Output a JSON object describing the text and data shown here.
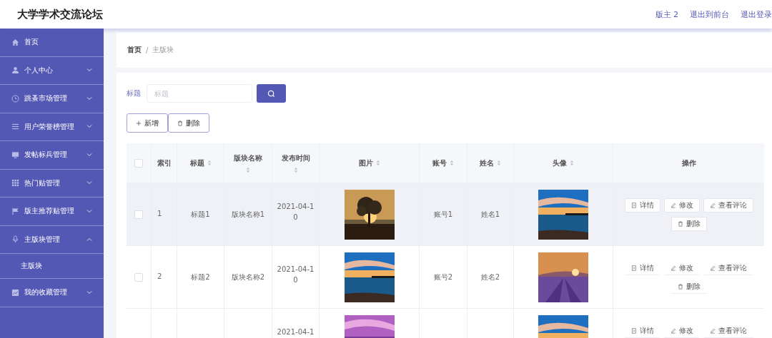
{
  "header": {
    "title": "大学学术交流论坛",
    "links": [
      "版主 2",
      "退出到前台",
      "退出登录"
    ]
  },
  "sidebar": {
    "items": [
      {
        "label": "首页"
      },
      {
        "label": "个人中心",
        "expanded": false
      },
      {
        "label": "跳蚤市场管理",
        "expanded": false
      },
      {
        "label": "用户荣誉榜管理",
        "expanded": false
      },
      {
        "label": "发帖标兵管理",
        "expanded": false
      },
      {
        "label": "热门贴管理",
        "expanded": false
      },
      {
        "label": "版主推荐贴管理",
        "expanded": false
      },
      {
        "label": "主版块管理",
        "expanded": true,
        "children": [
          {
            "label": "主版块"
          }
        ]
      },
      {
        "label": "我的收藏管理",
        "expanded": false
      }
    ]
  },
  "breadcrumb": [
    "首页",
    "/",
    "主版块"
  ],
  "search": {
    "label": "标题",
    "placeholder": "标题"
  },
  "actions": [
    {
      "label": "新增",
      "kind": "add"
    },
    {
      "label": "删除",
      "kind": "delete"
    }
  ],
  "table": {
    "select_all_checked": false,
    "columns": [
      {
        "label": "索引",
        "sortable": false
      },
      {
        "label": "标题",
        "sortable": true
      },
      {
        "label": "版块名称",
        "sortable": true
      },
      {
        "label": "发布时间",
        "sortable": true
      },
      {
        "label": "图片",
        "sortable": true
      },
      {
        "label": "账号",
        "sortable": true
      },
      {
        "label": "姓名",
        "sortable": true
      },
      {
        "label": "头像",
        "sortable": true
      },
      {
        "label": "操作",
        "sortable": false
      }
    ],
    "rows": [
      {
        "checked": false,
        "hovered": true,
        "index": "1",
        "title": "标题1",
        "section": "版块名称1",
        "date": "2021-04-10",
        "account": "账号1",
        "name": "姓名1",
        "buttons": [
          {
            "label": "详情",
            "kind": "detail"
          },
          {
            "label": "修改",
            "kind": "edit"
          },
          {
            "label": "查看评论",
            "kind": "edit"
          },
          {
            "label": "删除",
            "kind": "delete"
          }
        ]
      },
      {
        "checked": false,
        "hovered": false,
        "index": "2",
        "title": "标题2",
        "section": "版块名称2",
        "date": "2021-04-10",
        "account": "账号2",
        "name": "姓名2",
        "buttons": [
          {
            "label": "详情",
            "kind": "detail"
          },
          {
            "label": "修改",
            "kind": "edit"
          },
          {
            "label": "查看评论",
            "kind": "edit"
          },
          {
            "label": "删除",
            "kind": "delete"
          }
        ]
      },
      {
        "date": "2021-04-1",
        "buttons": [
          {
            "label": "详情",
            "kind": "detail"
          },
          {
            "label": "修改",
            "kind": "edit"
          },
          {
            "label": "查看评论",
            "kind": "edit"
          }
        ]
      }
    ]
  }
}
